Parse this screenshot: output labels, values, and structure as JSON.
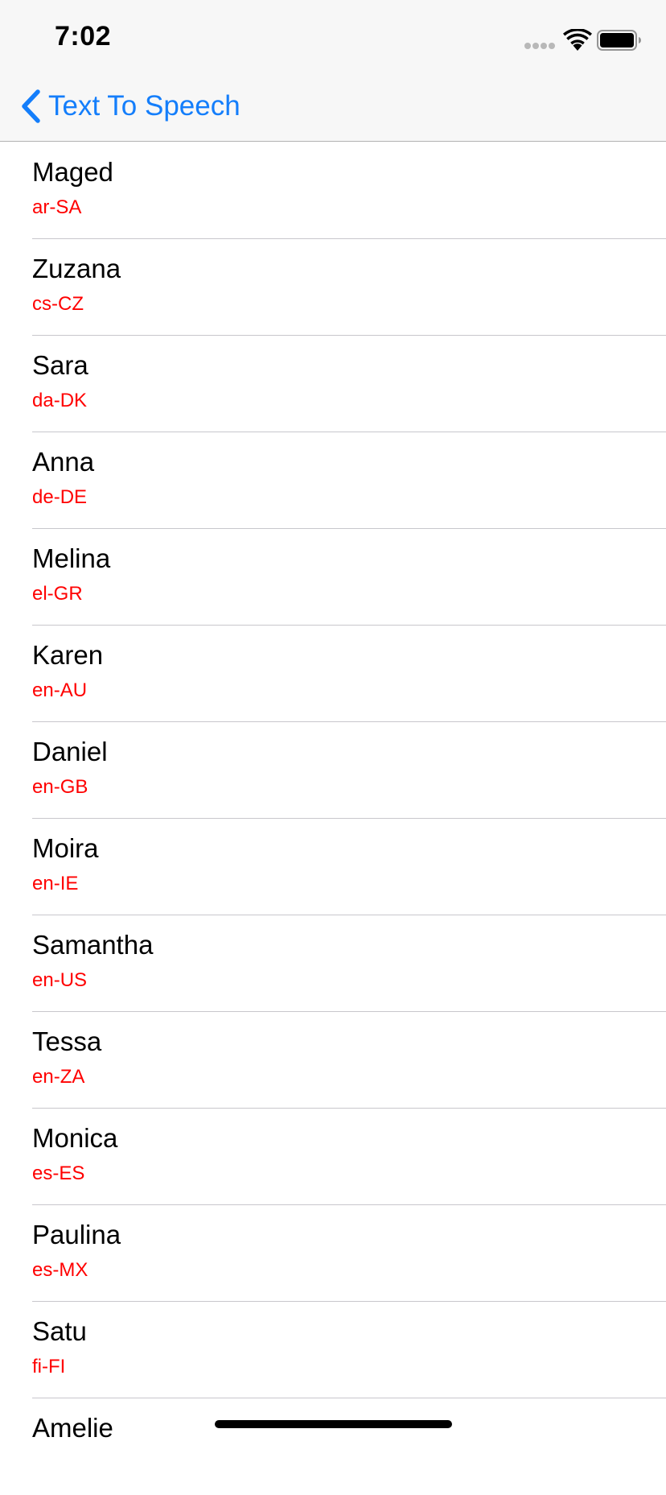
{
  "status_bar": {
    "time": "7:02"
  },
  "nav": {
    "back_label": "Text To Speech"
  },
  "colors": {
    "accent": "#147efb",
    "code_text": "#ff0000",
    "bar_background": "#f7f7f7"
  },
  "voices": [
    {
      "name": "Maged",
      "code": "ar-SA"
    },
    {
      "name": "Zuzana",
      "code": "cs-CZ"
    },
    {
      "name": "Sara",
      "code": "da-DK"
    },
    {
      "name": "Anna",
      "code": "de-DE"
    },
    {
      "name": "Melina",
      "code": "el-GR"
    },
    {
      "name": "Karen",
      "code": "en-AU"
    },
    {
      "name": "Daniel",
      "code": "en-GB"
    },
    {
      "name": "Moira",
      "code": "en-IE"
    },
    {
      "name": "Samantha",
      "code": "en-US"
    },
    {
      "name": "Tessa",
      "code": "en-ZA"
    },
    {
      "name": "Monica",
      "code": "es-ES"
    },
    {
      "name": "Paulina",
      "code": "es-MX"
    },
    {
      "name": "Satu",
      "code": "fi-FI"
    },
    {
      "name": "Amelie",
      "code": ""
    }
  ],
  "icons": {
    "signal": "cellular-signal-icon",
    "wifi": "wifi-icon",
    "battery": "battery-icon",
    "back": "chevron-left-icon"
  }
}
